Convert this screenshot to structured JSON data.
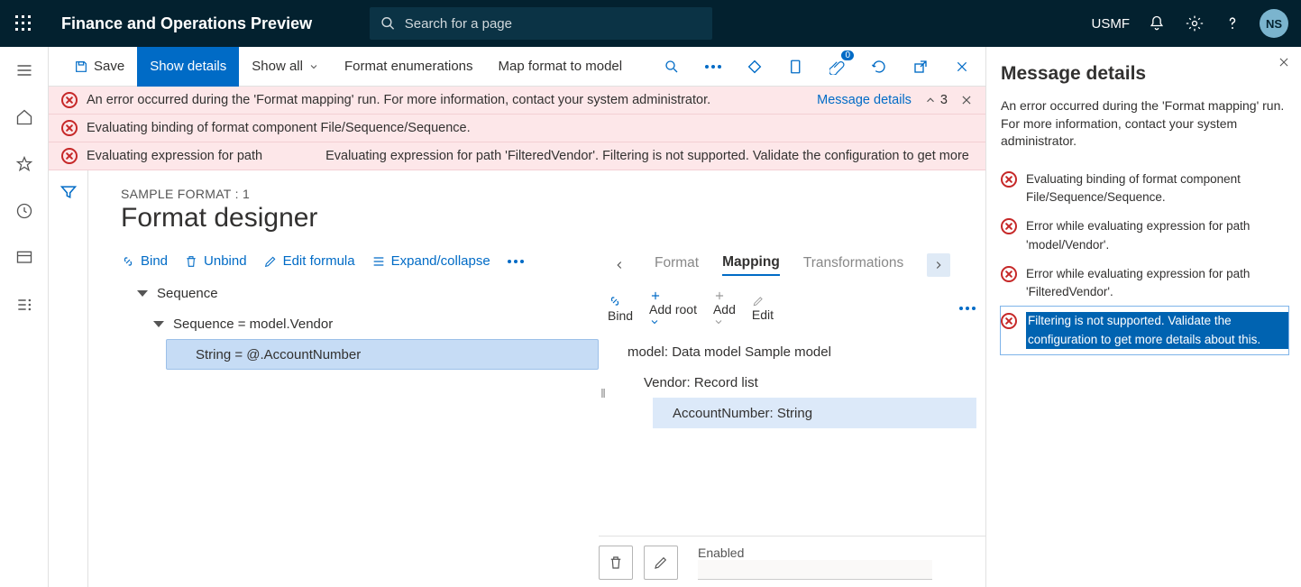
{
  "topbar": {
    "app_title": "Finance and Operations Preview",
    "search_placeholder": "Search for a page",
    "company": "USMF",
    "avatar_initials": "NS"
  },
  "cmdbar": {
    "save": "Save",
    "show_details": "Show details",
    "show_all": "Show all",
    "format_enums": "Format enumerations",
    "map_format": "Map format to model",
    "attachment_badge": "0"
  },
  "messages": {
    "row1": "An error occurred during the 'Format mapping' run. For more information, contact your system administrator.",
    "details_link": "Message details",
    "count": "3",
    "row2": "Evaluating binding of format component File/Sequence/Sequence.",
    "row3_a": "Evaluating expression for path",
    "row3_b": "Evaluating expression for path 'FilteredVendor'. Filtering is not supported. Validate the configuration to get more"
  },
  "designer": {
    "breadcrumb": "SAMPLE FORMAT : 1",
    "title": "Format designer",
    "left_toolbar": {
      "bind": "Bind",
      "unbind": "Unbind",
      "edit_formula": "Edit formula",
      "expand": "Expand/collapse"
    },
    "left_tree": {
      "n1": "Sequence",
      "n2": "Sequence = model.Vendor",
      "n3": "String = @.AccountNumber"
    },
    "right_tabs": {
      "format": "Format",
      "mapping": "Mapping",
      "transformations": "Transformations"
    },
    "right_toolbar": {
      "bind": "Bind",
      "add_root": "Add root",
      "add": "Add",
      "edit": "Edit"
    },
    "right_tree": {
      "n1": "model: Data model Sample model",
      "n2": "Vendor: Record list",
      "n3": "AccountNumber: String"
    },
    "bottom": {
      "enabled": "Enabled"
    }
  },
  "sidepanel": {
    "title": "Message details",
    "subtitle": "An error occurred during the 'Format mapping' run. For more information, contact your system administrator.",
    "items": {
      "i1": "Evaluating binding of format component File/Sequence/Sequence.",
      "i2": "Error while evaluating expression for path 'model/Vendor'.",
      "i3": "Error while evaluating expression for path 'FilteredVendor'.",
      "i4": "Filtering is not supported. Validate the configuration to get more details about this."
    }
  }
}
